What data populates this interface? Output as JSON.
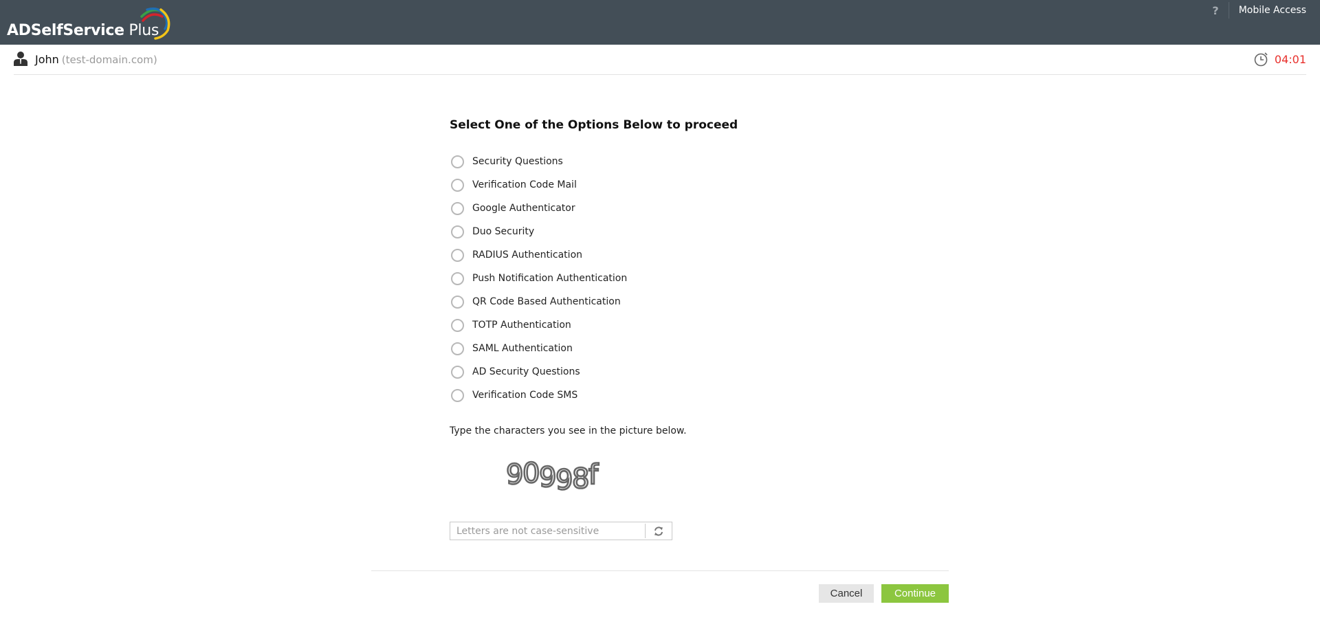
{
  "header": {
    "logo": {
      "bold_part": "ADSelfService",
      "light_part": " Plus",
      "arc_colors": [
        "#d3242c",
        "#3aa047",
        "#1f6fb5",
        "#f2c418"
      ]
    },
    "help_label": "?",
    "mobile_access_label": "Mobile Access"
  },
  "userbar": {
    "icon": "user-icon",
    "name": "John",
    "domain": "(test-domain.com)",
    "timer_icon": "clock-icon",
    "timer": "04:01",
    "timer_color": "#e8302c"
  },
  "main": {
    "title": "Select One of the Options Below to proceed",
    "options": [
      {
        "label": "Security Questions",
        "selected": false
      },
      {
        "label": "Verification Code Mail",
        "selected": false
      },
      {
        "label": "Google Authenticator",
        "selected": false
      },
      {
        "label": "Duo Security",
        "selected": false
      },
      {
        "label": "RADIUS Authentication",
        "selected": false
      },
      {
        "label": "Push Notification Authentication",
        "selected": false
      },
      {
        "label": "QR Code Based Authentication",
        "selected": false
      },
      {
        "label": "TOTP Authentication",
        "selected": false
      },
      {
        "label": "SAML Authentication",
        "selected": false
      },
      {
        "label": "AD Security Questions",
        "selected": false
      },
      {
        "label": "Verification Code SMS",
        "selected": false
      }
    ],
    "captcha": {
      "prompt": "Type the characters you see in the picture below.",
      "image_text": "90998f",
      "input_value": "",
      "input_placeholder": "Letters are not case-sensitive",
      "refresh_icon": "refresh-icon"
    }
  },
  "footer": {
    "cancel_label": "Cancel",
    "continue_label": "Continue",
    "continue_color": "#8cc63f"
  }
}
